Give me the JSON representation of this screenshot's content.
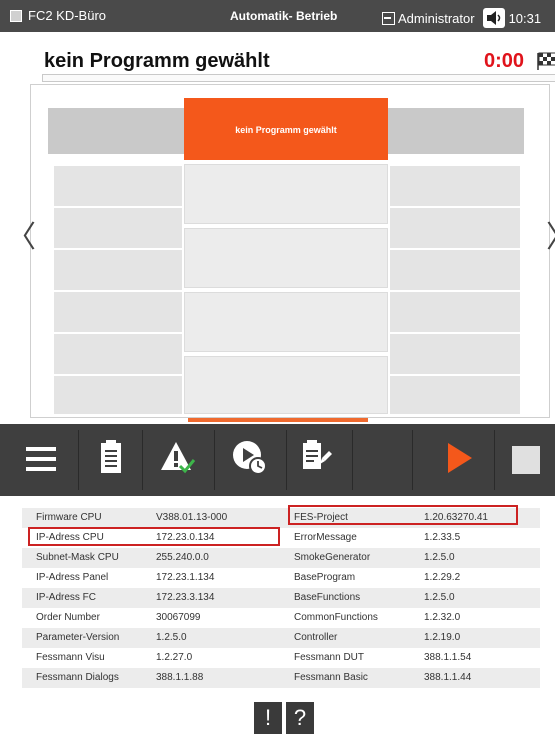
{
  "status_bar": {
    "station": "FC2 KD-Büro",
    "mode": "Automatik- Betrieb",
    "user": "Administrator",
    "clock": "10:31"
  },
  "header": {
    "program_title": "kein Programm gewählt",
    "time": "0:00"
  },
  "program_slot": {
    "label": "kein Programm gewählt"
  },
  "navigation": {
    "prev": "〈",
    "next": "〉"
  },
  "toolbar": {
    "icons": [
      "menu-icon",
      "notepad-icon",
      "warning-check-icon",
      "play-timer-icon",
      "edit-list-icon",
      "play-icon",
      "stop-icon"
    ],
    "accent_color": "#f4581b"
  },
  "info_table": {
    "rows": [
      {
        "label1": "Firmware CPU",
        "value1": "V388.01.13-000",
        "label2": "FES-Project",
        "value2": "1.20.63270.41"
      },
      {
        "label1": "IP-Adress CPU",
        "value1": "172.23.0.134",
        "label2": "ErrorMessage",
        "value2": "1.2.33.5"
      },
      {
        "label1": "Subnet-Mask CPU",
        "value1": "255.240.0.0",
        "label2": "SmokeGenerator",
        "value2": "1.2.5.0"
      },
      {
        "label1": "IP-Adress Panel",
        "value1": "172.23.1.134",
        "label2": "BaseProgram",
        "value2": "1.2.29.2"
      },
      {
        "label1": "IP-Adress FC",
        "value1": "172.23.3.134",
        "label2": "BaseFunctions",
        "value2": "1.2.5.0"
      },
      {
        "label1": "Order Number",
        "value1": "30067099",
        "label2": "CommonFunctions",
        "value2": "1.2.32.0"
      },
      {
        "label1": "Parameter-Version",
        "value1": "1.2.5.0",
        "label2": "Controller",
        "value2": "1.2.19.0"
      },
      {
        "label1": "Fessmann Visu",
        "value1": "1.2.27.0",
        "label2": "Fessmann DUT",
        "value2": "388.1.1.54"
      },
      {
        "label1": "Fessmann Dialogs",
        "value1": "388.1.1.88",
        "label2": "Fessmann Basic",
        "value2": "388.1.1.44"
      }
    ]
  },
  "bottom_buttons": {
    "alert": "!",
    "help": "?"
  }
}
